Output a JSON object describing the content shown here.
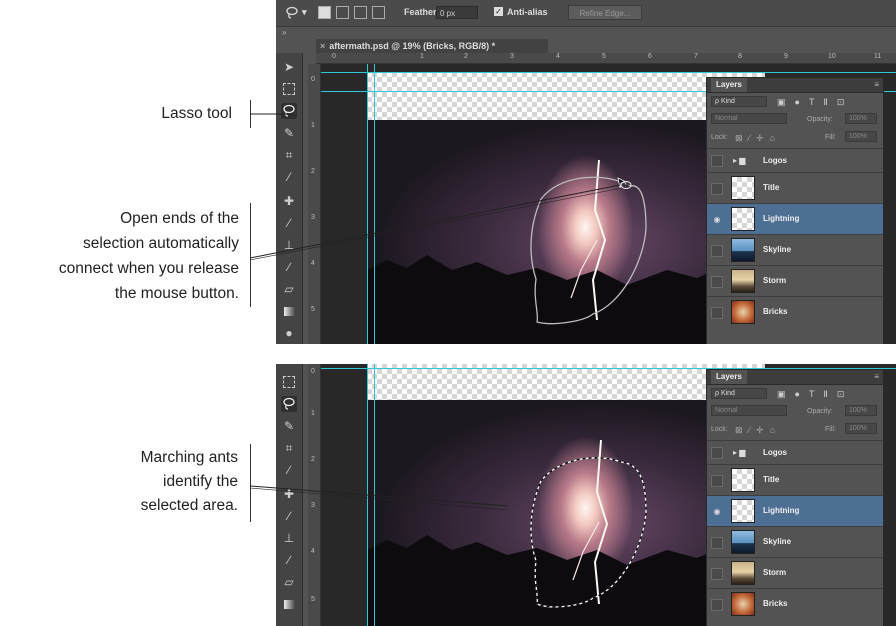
{
  "callouts": {
    "lasso_tool": "Lasso tool",
    "open_ends": [
      "Open ends of the",
      "selection automatically",
      "connect when you release",
      "the mouse button."
    ],
    "marching_ants": [
      "Marching ants",
      "identify the",
      "selected area."
    ]
  },
  "options_bar": {
    "feather_label": "Feather:",
    "feather_value": "0 px",
    "anti_alias_label": "Anti-alias",
    "refine_edge_label": "Refine Edge..."
  },
  "document": {
    "tab_title": "aftermath.psd @ 19% (Bricks, RGB/8) *"
  },
  "ruler": {
    "h_labels": [
      "0",
      "1",
      "2",
      "3",
      "4",
      "5",
      "6",
      "7",
      "8",
      "9",
      "10",
      "11"
    ],
    "v_labels": [
      "0",
      "1",
      "2",
      "3",
      "4",
      "5"
    ]
  },
  "layers_panel": {
    "tab_label": "Layers",
    "kind_label": "Kind",
    "blend_mode": "Normal",
    "opacity_label": "Opacity:",
    "opacity_value": "100%",
    "lock_label": "Lock:",
    "fill_label": "Fill:",
    "fill_value": "100%",
    "layers": [
      {
        "name": "Logos",
        "type": "folder",
        "visible": false,
        "active": false
      },
      {
        "name": "Title",
        "type": "layer",
        "visible": false,
        "active": false
      },
      {
        "name": "Lightning",
        "type": "layer",
        "visible": true,
        "active": true
      },
      {
        "name": "Skyline",
        "type": "layer",
        "visible": false,
        "active": false
      },
      {
        "name": "Storm",
        "type": "layer",
        "visible": false,
        "active": false
      },
      {
        "name": "Bricks",
        "type": "layer",
        "visible": false,
        "active": false
      }
    ]
  },
  "colors": {
    "ui_dark": "#535353",
    "selected_layer": "#4e6f94",
    "guide": "#30c8d8"
  }
}
